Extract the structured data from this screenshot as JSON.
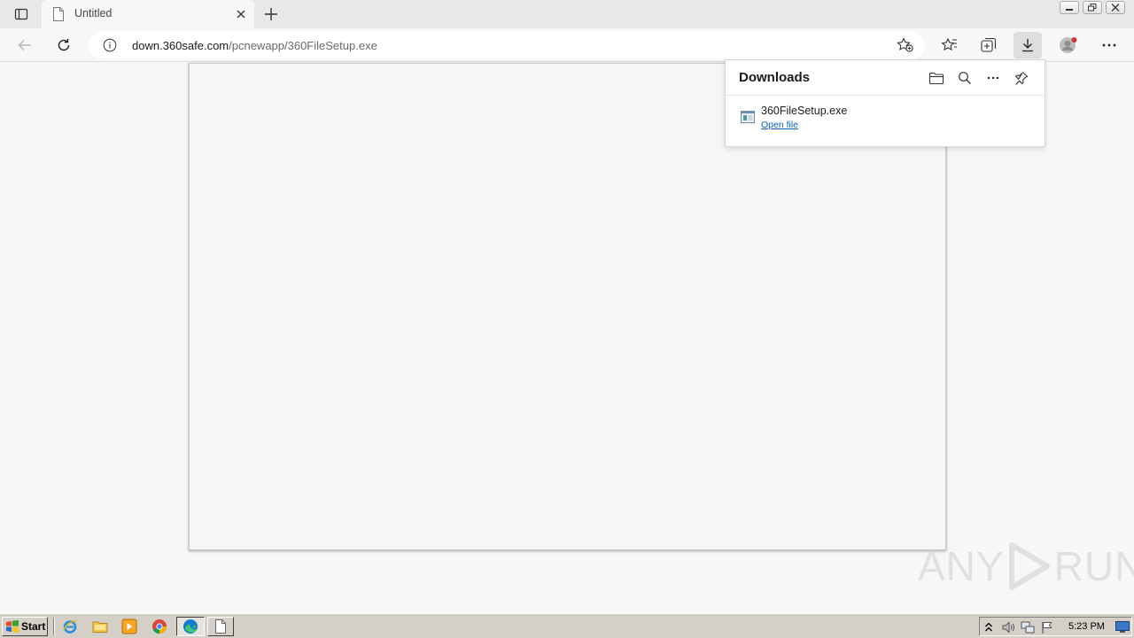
{
  "tab": {
    "title": "Untitled"
  },
  "address": {
    "host": "down.360safe.com",
    "path": "/pcnewapp/360FileSetup.exe"
  },
  "downloads": {
    "title": "Downloads",
    "items": [
      {
        "filename": "360FileSetup.exe",
        "action": "Open file"
      }
    ]
  },
  "watermark": {
    "text_left": "ANY",
    "text_right": "RUN"
  },
  "taskbar": {
    "start_label": "Start",
    "clock": "5:23 PM"
  },
  "colors": {
    "link": "#0c5fb3",
    "profile_badge": "#d13438",
    "edge_blue": "#0f7bd6"
  }
}
